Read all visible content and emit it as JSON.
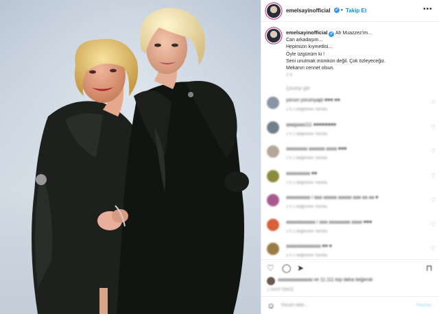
{
  "post": {
    "username": "emelsayinofficial",
    "verified_mark": "✔",
    "follow_separator": "•",
    "follow_label": "Takip Et",
    "more_label": "•••",
    "caption_lines": [
      "Ah Muazzez'im...",
      "Can arkadaşım...",
      "Hepimizin kıymetlisi...",
      "Öyle üzgünüm ki !",
      "Seni unutmak mümkün değil. Çok özleyeceğiz.",
      "Mekanın cennet olsun."
    ],
    "caption_time": "1 h",
    "caption_extra": "Çeviriyi gör"
  },
  "comments": [
    {
      "text": "yorum yorumyapt ♥♥♥ ♥♥",
      "meta": "1 h   1 beğenme   Yanıtla",
      "avatar_color": "#8a94a6"
    },
    {
      "text": "aaagaaa111 ♥♥♥♥♥♥♥♥",
      "meta": "1 h   1 beğenme   Yanıtla",
      "avatar_color": "#6f7f8c"
    },
    {
      "text": "aaaaaaaa aaaaaa aaaa ♥♥♥",
      "meta": "1 h   1 beğenme   Yanıtla",
      "avatar_color": "#b3a79a"
    },
    {
      "text": "aaaaaaaaa ♥♥",
      "meta": "1 h   1 beğenme   Yanıtla",
      "avatar_color": "#8c8a3b"
    },
    {
      "text": "aaaaaaaaa / aaa aaaaa aaaaa aaa aa aa ♥",
      "meta": "1 h   1 beğenme   Yanıtla",
      "avatar_color": "#a75b8c"
    },
    {
      "text": "aaaaaaaaaaa / aaa aaaaaaaa aaaa ♥♥♥",
      "meta": "1 h   1 beğenme   Yanıtla",
      "avatar_color": "#d6603a"
    },
    {
      "text": "aaaaaaaaaaaaa ♥♥ ♥",
      "meta": "1 h   1 beğenme   Yanıtla",
      "avatar_color": "#9a7b44"
    }
  ],
  "likes_text": "aaaaaaaaaaaaa ve 11.111 kişi daha beğendi",
  "post_age": "1 SAAT ÖNCE",
  "add_comment_placeholder": "Yorum ekle...",
  "post_button_label": "Paylaş",
  "icons": [
    "heart-icon",
    "comment-icon",
    "share-icon",
    "bookmark-icon",
    "emoji-icon"
  ]
}
